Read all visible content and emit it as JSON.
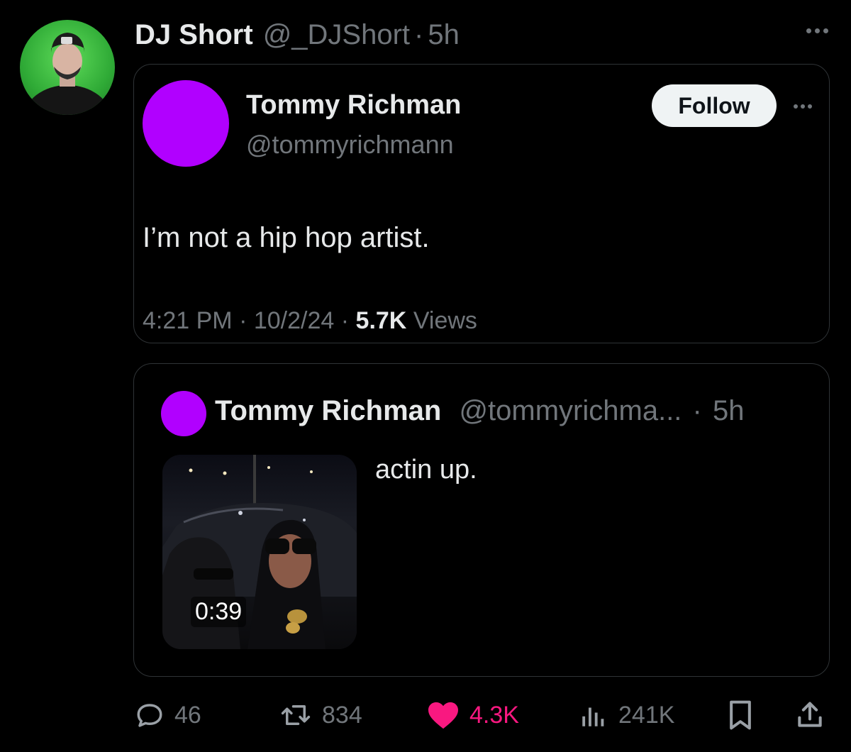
{
  "post": {
    "author_name": "DJ Short",
    "author_handle": "@_DJShort",
    "dot": "·",
    "time": "5h"
  },
  "embedded_profile": {
    "name": "Tommy Richman",
    "handle": "@tommyrichmann",
    "follow_label": "Follow",
    "text": "I’m not a hip hop artist.",
    "time": "4:21 PM",
    "date": "10/2/24",
    "views_count": "5.7K",
    "views_label": "Views",
    "dot": "·"
  },
  "quoted_post": {
    "name": "Tommy Richman",
    "handle": "@tommyrichma...",
    "dot": "·",
    "time": "5h",
    "text": "actin up.",
    "video_duration": "0:39"
  },
  "actions": {
    "replies": "46",
    "reposts": "834",
    "likes": "4.3K",
    "views": "241K"
  },
  "colors": {
    "background": "#000000",
    "text_primary": "#e7e9ea",
    "text_secondary": "#71767b",
    "like_pink": "#f91880",
    "avatar_purple": "#b100ff",
    "avatar_green": "#3fbf3f",
    "border": "#2f3336"
  },
  "icons": [
    "more-icon",
    "reply-icon",
    "retweet-icon",
    "heart-icon",
    "views-icon",
    "bookmark-icon",
    "share-icon"
  ]
}
